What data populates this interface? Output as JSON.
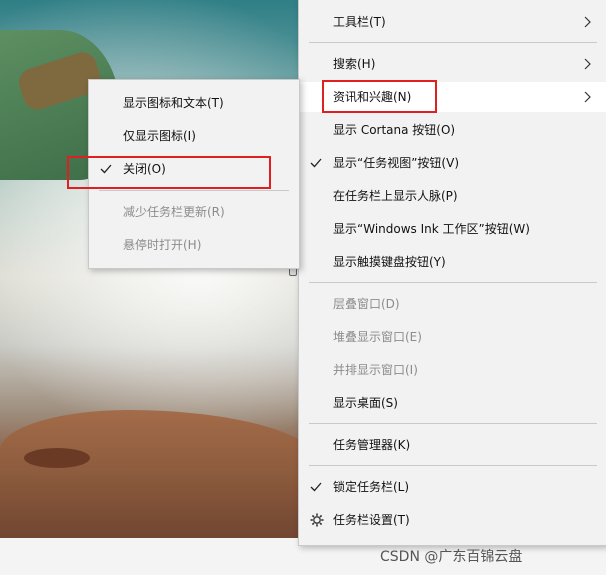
{
  "main_menu": {
    "items": [
      {
        "label": "工具栏(T)",
        "has_submenu": true
      },
      {
        "label": "搜索(H)",
        "has_submenu": true
      },
      {
        "label": "资讯和兴趣(N)",
        "has_submenu": true,
        "highlighted": true
      },
      {
        "label": "显示 Cortana 按钮(O)"
      },
      {
        "label": "显示“任务视图”按钮(V)",
        "checked": true
      },
      {
        "label": "在任务栏上显示人脉(P)"
      },
      {
        "label": "显示“Windows Ink 工作区”按钮(W)"
      },
      {
        "label": "显示触摸键盘按钮(Y)"
      },
      {
        "label": "层叠窗口(D)",
        "disabled": true
      },
      {
        "label": "堆叠显示窗口(E)",
        "disabled": true
      },
      {
        "label": "并排显示窗口(I)",
        "disabled": true
      },
      {
        "label": "显示桌面(S)"
      },
      {
        "label": "任务管理器(K)"
      },
      {
        "label": "锁定任务栏(L)",
        "checked": true
      },
      {
        "label": "任务栏设置(T)",
        "icon": "gear-icon"
      }
    ]
  },
  "sub_menu": {
    "items": [
      {
        "label": "显示图标和文本(T)"
      },
      {
        "label": "仅显示图标(I)"
      },
      {
        "label": "关闭(O)",
        "checked": true
      },
      {
        "label": "减少任务栏更新(R)",
        "disabled": true
      },
      {
        "label": "悬停时打开(H)",
        "disabled": true
      }
    ]
  },
  "taskbar_watermark": "CSDN @广东百锦云盘",
  "colors": {
    "menu_bg": "#f2f2f2",
    "highlight_bg": "#ffffff",
    "disabled_text": "#8c8c8c",
    "annotation_red": "#e02020"
  }
}
